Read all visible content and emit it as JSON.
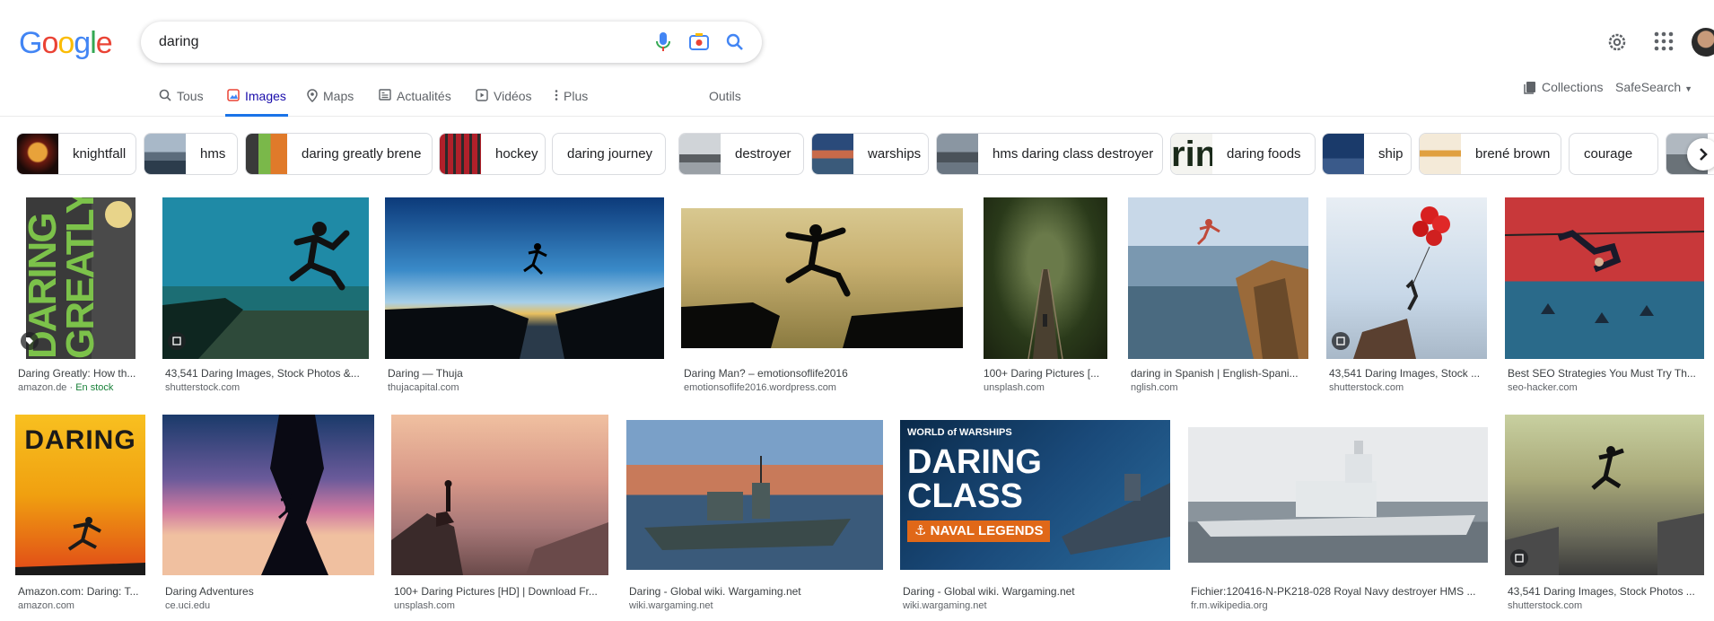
{
  "logo": "Google",
  "search": {
    "query": "daring"
  },
  "tabs": [
    {
      "label": "Tous"
    },
    {
      "label": "Images"
    },
    {
      "label": "Maps"
    },
    {
      "label": "Actualités"
    },
    {
      "label": "Vidéos"
    },
    {
      "label": "Plus"
    }
  ],
  "tools_label": "Outils",
  "collections_label": "Collections",
  "safesearch_label": "SafeSearch",
  "chips": [
    {
      "label": "knightfall"
    },
    {
      "label": "hms"
    },
    {
      "label": "daring greatly brene"
    },
    {
      "label": "hockey"
    },
    {
      "label": "daring journey"
    },
    {
      "label": "destroyer"
    },
    {
      "label": "warships"
    },
    {
      "label": "hms daring class destroyer"
    },
    {
      "label": "daring foods"
    },
    {
      "label": "ship"
    },
    {
      "label": "brené brown"
    },
    {
      "label": "courage"
    }
  ],
  "results": [
    {
      "title": "Daring Greatly: How th...",
      "source": "amazon.de",
      "extra": "En stock"
    },
    {
      "title": "43,541 Daring Images, Stock Photos &...",
      "source": "shutterstock.com"
    },
    {
      "title": "Daring — Thuja",
      "source": "thujacapital.com"
    },
    {
      "title": "Daring Man? – emotionsoflife2016",
      "source": "emotionsoflife2016.wordpress.com"
    },
    {
      "title": "100+ Daring Pictures [...",
      "source": "unsplash.com"
    },
    {
      "title": "daring in Spanish | English-Spani...",
      "source": "nglish.com"
    },
    {
      "title": "43,541 Daring Images, Stock ...",
      "source": "shutterstock.com"
    },
    {
      "title": "Best SEO Strategies You Must Try Th...",
      "source": "seo-hacker.com"
    },
    {
      "title": "Amazon.com: Daring: T...",
      "source": "amazon.com"
    },
    {
      "title": "Daring Adventures",
      "source": "ce.uci.edu"
    },
    {
      "title": "100+ Daring Pictures [HD] | Download Fr...",
      "source": "unsplash.com"
    },
    {
      "title": "Daring - Global wiki. Wargaming.net",
      "source": "wiki.wargaming.net"
    },
    {
      "title": "Daring - Global wiki. Wargaming.net",
      "source": "wiki.wargaming.net"
    },
    {
      "title": "Fichier:120416-N-PK218-028 Royal Navy destroyer HMS ...",
      "source": "fr.m.wikipedia.org"
    },
    {
      "title": "43,541 Daring Images, Stock Photos ...",
      "source": "shutterstock.com"
    }
  ],
  "image_text": {
    "book1": "DARING GREATLY",
    "book2": "DARING",
    "wows_brand": "WORLD of WARSHIPS",
    "wows_title1": "DARING",
    "wows_title2": "CLASS",
    "wows_sub": "NAVAL LEGENDS"
  },
  "colors": {
    "accent": "#1a73e8",
    "active_tab": "#1a0dab",
    "stock_green": "#188038"
  }
}
